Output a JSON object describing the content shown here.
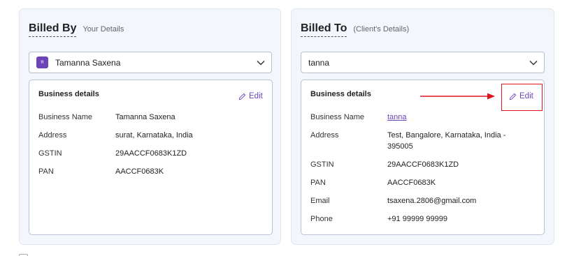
{
  "billed_by": {
    "title": "Billed By",
    "subtitle": "Your Details",
    "selected": "Tamanna Saxena",
    "avatar_text": "R",
    "card_title": "Business details",
    "edit_label": "Edit",
    "rows": [
      {
        "label": "Business Name",
        "value": "Tamanna Saxena"
      },
      {
        "label": "Address",
        "value": "surat, Karnataka, India"
      },
      {
        "label": "GSTIN",
        "value": "29AACCF0683K1ZD"
      },
      {
        "label": "PAN",
        "value": "AACCF0683K"
      }
    ]
  },
  "billed_to": {
    "title": "Billed To",
    "subtitle": "(Client's Details)",
    "selected": "tanna",
    "card_title": "Business details",
    "edit_label": "Edit",
    "rows": [
      {
        "label": "Business Name",
        "value": "tanna"
      },
      {
        "label": "Address",
        "value": "Test, Bangalore, Karnataka, India -\n395005"
      },
      {
        "label": "GSTIN",
        "value": "29AACCF0683K1ZD"
      },
      {
        "label": "PAN",
        "value": "AACCF0683K"
      },
      {
        "label": "Email",
        "value": "tsaxena.2806@gmail.com"
      },
      {
        "label": "Phone",
        "value": "+91 99999 99999"
      }
    ]
  },
  "colors": {
    "accent": "#6a44b8",
    "highlight": "#e0141e",
    "panel_bg": "#f3f6fc"
  },
  "icons": [
    "chevron-down-icon",
    "pencil-icon",
    "arrow-right-icon"
  ]
}
